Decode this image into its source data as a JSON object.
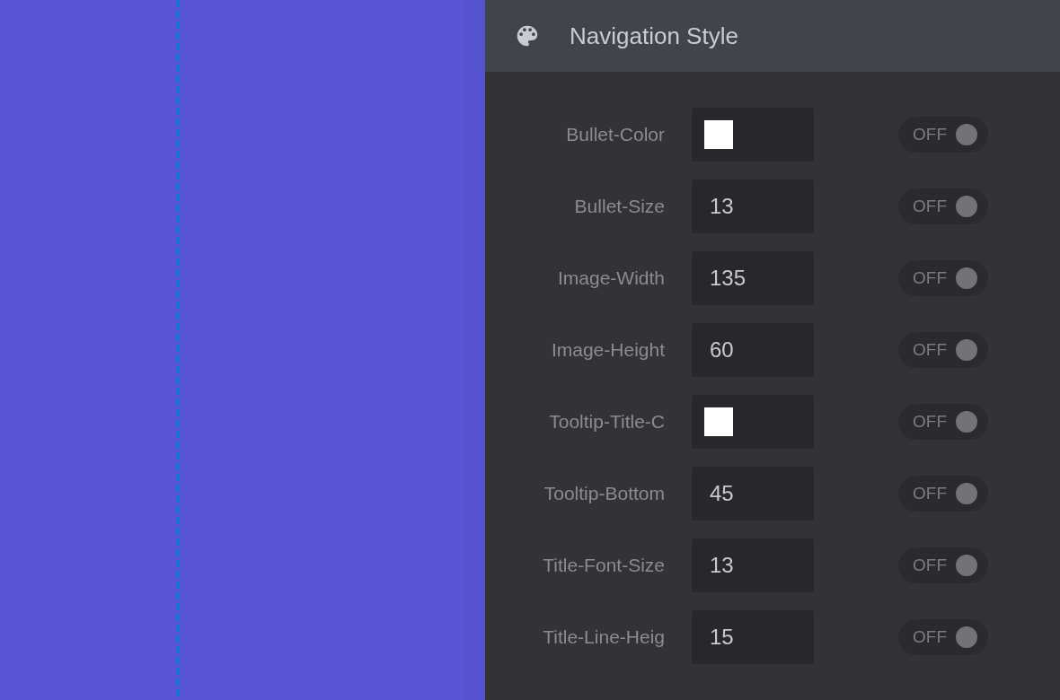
{
  "panel": {
    "title": "Navigation Style"
  },
  "rows": [
    {
      "label": "Bullet-Color",
      "kind": "color",
      "color": "#ffffff",
      "toggle": {
        "label": "OFF",
        "on": false
      }
    },
    {
      "label": "Bullet-Size",
      "kind": "number",
      "value": "13",
      "toggle": {
        "label": "OFF",
        "on": false
      }
    },
    {
      "label": "Image-Width",
      "kind": "number",
      "value": "135",
      "toggle": {
        "label": "OFF",
        "on": false
      }
    },
    {
      "label": "Image-Height",
      "kind": "number",
      "value": "60",
      "toggle": {
        "label": "OFF",
        "on": false
      }
    },
    {
      "label": "Tooltip-Title-C",
      "kind": "color",
      "color": "#ffffff",
      "toggle": {
        "label": "OFF",
        "on": false
      }
    },
    {
      "label": "Tooltip-Bottom",
      "kind": "number",
      "value": "45",
      "toggle": {
        "label": "OFF",
        "on": false
      }
    },
    {
      "label": "Title-Font-Size",
      "kind": "number",
      "value": "13",
      "toggle": {
        "label": "OFF",
        "on": false
      }
    },
    {
      "label": "Title-Line-Heig",
      "kind": "number",
      "value": "15",
      "toggle": {
        "label": "OFF",
        "on": false
      }
    }
  ]
}
